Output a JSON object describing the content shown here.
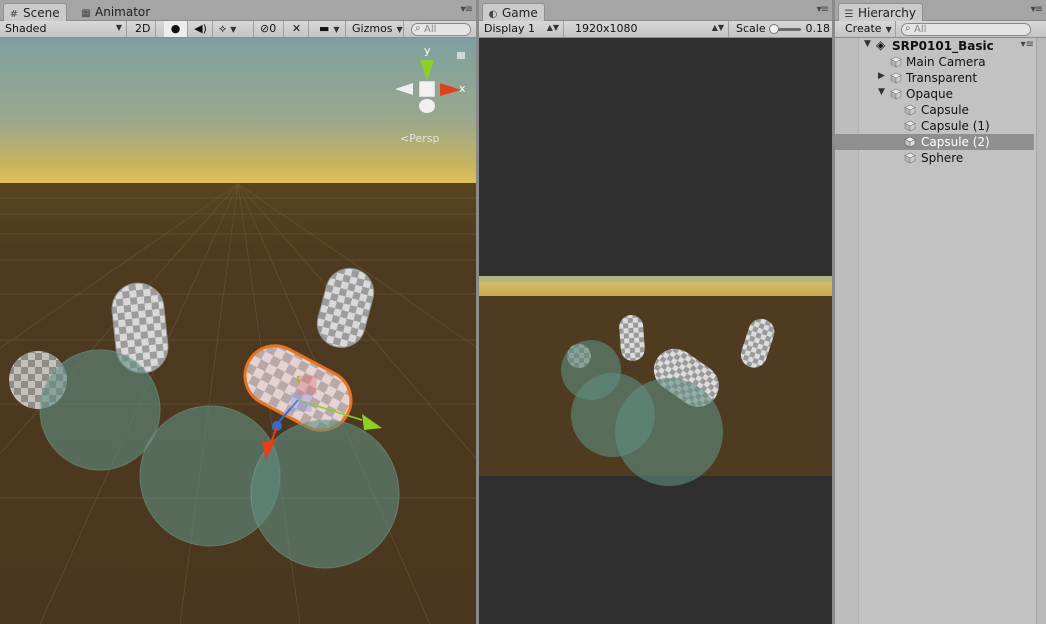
{
  "scene_panel": {
    "tabs": [
      {
        "label": "Scene",
        "icon": "grid-icon",
        "active": true
      },
      {
        "label": "Animator",
        "icon": "animator-icon",
        "active": false
      }
    ],
    "toolbar": {
      "shading_mode": "Shaded",
      "mode_2d": "2D",
      "hidden_count": "0",
      "gizmos_label": "Gizmos",
      "search_placeholder": "All"
    },
    "view": {
      "projection_label": "Persp",
      "axis_y": "y",
      "axis_x": "x"
    }
  },
  "game_panel": {
    "tab": {
      "label": "Game",
      "icon": "game-icon"
    },
    "toolbar": {
      "display": "Display 1",
      "resolution": "1920x1080",
      "scale_label": "Scale",
      "scale_value": "0.18"
    }
  },
  "hierarchy_panel": {
    "tab": {
      "label": "Hierarchy",
      "icon": "list-icon"
    },
    "toolbar": {
      "create_label": "Create",
      "search_placeholder": "All"
    },
    "scene_name": "SRP0101_Basic",
    "items": [
      {
        "label": "Main Camera",
        "depth": 1,
        "expandable": false,
        "expanded": false,
        "selected": false
      },
      {
        "label": "Transparent",
        "depth": 1,
        "expandable": true,
        "expanded": false,
        "selected": false
      },
      {
        "label": "Opaque",
        "depth": 1,
        "expandable": true,
        "expanded": true,
        "selected": false
      },
      {
        "label": "Capsule",
        "depth": 2,
        "expandable": false,
        "expanded": false,
        "selected": false
      },
      {
        "label": "Capsule (1)",
        "depth": 2,
        "expandable": false,
        "expanded": false,
        "selected": false
      },
      {
        "label": "Capsule (2)",
        "depth": 2,
        "expandable": false,
        "expanded": false,
        "selected": true
      },
      {
        "label": "Sphere",
        "depth": 2,
        "expandable": false,
        "expanded": false,
        "selected": false
      }
    ]
  },
  "colors": {
    "ground": "#4d3a20",
    "selection_outline": "#e8741c",
    "axis_x": "#e0401c",
    "axis_y": "#8ccf27",
    "axis_z": "#2f6cd8",
    "sphere_tint": "#5f8e82"
  }
}
